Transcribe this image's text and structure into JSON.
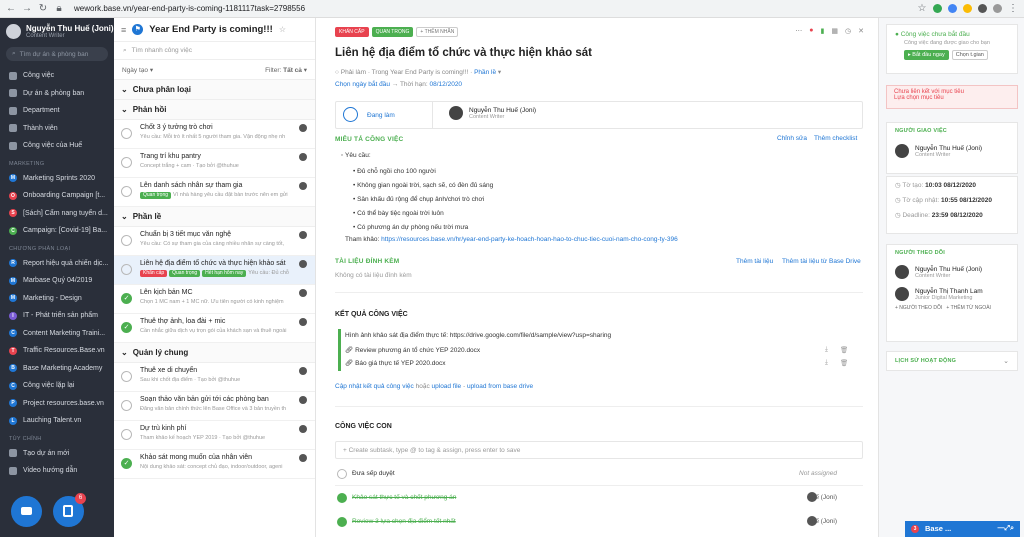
{
  "browser": {
    "url": "wework.base.vn/year-end-party-is-coming-1181117task=2798556"
  },
  "sidebar": {
    "user_name": "Nguyễn Thu Huế (Joni)",
    "user_role": "Content Writer",
    "search_placeholder": "Tìm dự án & phòng ban",
    "main_items": [
      {
        "label": "Công việc"
      },
      {
        "label": "Dự án & phòng ban"
      },
      {
        "label": "Department"
      },
      {
        "label": "Thành viên"
      },
      {
        "label": "Công việc của Huế"
      }
    ],
    "section_marketing": "MARKETING",
    "marketing_items": [
      {
        "label": "Marketing Sprints 2020",
        "letter": "M",
        "color": "#1f76d4"
      },
      {
        "label": "Onboarding Campaign [t...",
        "letter": "O",
        "color": "#e8434f"
      },
      {
        "label": "[Sách] Cẩm nang tuyển d...",
        "letter": "S",
        "color": "#e8434f"
      },
      {
        "label": "Campaign: [Covid-19] Ba...",
        "letter": "C",
        "color": "#4caf50"
      }
    ],
    "section_chapter": "CHƯƠNG PHÂN LOẠI",
    "chapter_items": [
      {
        "label": "Report hiệu quả chiến dịc...",
        "letter": "R",
        "color": "#1f76d4"
      },
      {
        "label": "Marbase Quý 04/2019",
        "letter": "M",
        "color": "#1f76d4"
      },
      {
        "label": "Marketing - Design",
        "letter": "M",
        "color": "#1f76d4"
      },
      {
        "label": "IT - Phát triển sản phẩm",
        "letter": "I",
        "color": "#7b5cd6"
      },
      {
        "label": "Content Marketing Traini...",
        "letter": "C",
        "color": "#1f76d4"
      },
      {
        "label": "Traffic Resources.Base.vn",
        "letter": "T",
        "color": "#e8434f"
      },
      {
        "label": "Base Marketing Academy",
        "letter": "B",
        "color": "#1f76d4"
      },
      {
        "label": "Công việc lặp lại",
        "letter": "C",
        "color": "#1f76d4"
      },
      {
        "label": "Project resources.base.vn",
        "letter": "P",
        "color": "#1f76d4"
      },
      {
        "label": "Lauching Talent.vn",
        "letter": "L",
        "color": "#1f76d4"
      }
    ],
    "section_custom": "TÙY CHỈNH",
    "custom_items": [
      {
        "label": "Tạo dự án mới"
      },
      {
        "label": "Video hướng dẫn"
      }
    ],
    "fab_badge": "6"
  },
  "list": {
    "project_title": "Year End Party is coming!!!",
    "search_placeholder": "Tìm nhanh công việc",
    "sort_label": "Ngày tạo",
    "filter_label": "Filter:",
    "filter_value": "Tất cả",
    "groups": [
      {
        "name": "Chưa phân loại",
        "tasks": []
      },
      {
        "name": "Phản hồi",
        "tasks": [
          {
            "title": "Chốt 3 ý tưởng trò chơi",
            "sub": "Yêu cầu: Mỗi trò ít nhất 5 người tham gia. Vận động nhẹ nh",
            "done": false
          },
          {
            "title": "Trang trí khu pantry",
            "sub": "Concept trắng + cam · Tạo bởi @thuhue",
            "done": false
          },
          {
            "title": "Lên danh sách nhân sự tham gia",
            "sub": "Vì nhà hàng yêu cầu đặt bàn trước nên em gửi",
            "done": false,
            "tags": [
              {
                "t": "Quan trọng",
                "c": "#4caf50"
              }
            ]
          }
        ]
      },
      {
        "name": "Phần lề",
        "tasks": [
          {
            "title": "Chuẩn bị 3 tiết mục văn nghệ",
            "sub": "Yêu cầu: Có sự tham gia của càng nhiều nhân sự càng tốt,",
            "done": false
          },
          {
            "title": "Liên hệ địa điểm tổ chức và thực hiện khảo sát",
            "sub": "Yêu cầu: Đủ chỗ",
            "done": false,
            "sel": true,
            "tags": [
              {
                "t": "Khẩn cấp",
                "c": "#e8434f"
              },
              {
                "t": "Quan trọng",
                "c": "#4caf50"
              },
              {
                "t": "Hết hạn hôm nay",
                "c": "#4caf50"
              }
            ]
          },
          {
            "title": "Lên kịch bản MC",
            "sub": "Chọn 1 MC nam + 1 MC nữ. Ưu tiên người có kinh nghiệm",
            "done": true
          },
          {
            "title": "Thuê thợ ảnh, loa đài + mic",
            "sub": "Cần nhắc giữa dịch vụ trọn gói của khách sạn và thuê ngoài",
            "done": true
          }
        ]
      },
      {
        "name": "Quản lý chung",
        "tasks": [
          {
            "title": "Thuê xe di chuyển",
            "sub": "Sau khi chốt địa điểm · Tạo bởi @thuhue",
            "done": false
          },
          {
            "title": "Soạn thảo văn bản gửi tới các phòng ban",
            "sub": "Đăng văn bản chính thức lên Base Office và 3 bản truyền th",
            "done": false
          },
          {
            "title": "Dự trù kinh phí",
            "sub": "Tham khảo kế hoạch YEP 2019 · Tạo bởi @thuhue",
            "done": false
          },
          {
            "title": "Khảo sát mong muốn của nhân viên",
            "sub": "Nội dung khảo sát: concept chủ đạo, indoor/outdoor, ageni",
            "done": true
          }
        ]
      }
    ]
  },
  "detail": {
    "tags": [
      {
        "t": "KHẨN CẤP",
        "bg": "#e8434f",
        "fg": "#ffffff"
      },
      {
        "t": "QUAN TRỌNG",
        "bg": "#4caf50",
        "fg": "#ffffff"
      },
      {
        "t": "+ THÊM NHÃN",
        "bg": "#ffffff",
        "fg": "#777777"
      }
    ],
    "title": "Liên hệ địa điểm tổ chức và thực hiện khảo sát",
    "meta": "Phải làm · Trong Year End Party is coming!!!",
    "meta_link": "Phần lề",
    "start_date": "Chọn ngày bắt đầu",
    "deadline_label": "Thời hạn:",
    "deadline": "08/12/2020",
    "status": "Đang làm",
    "assignee_name": "Nguyễn Thu Huế (Joni)",
    "assignee_role": "Content Writer",
    "desc_header": "MIÊU TẢ CÔNG VIỆC",
    "desc_edit": "Chỉnh sửa",
    "desc_checklist": "Thêm checklist",
    "req_label": "Yêu cầu:",
    "requirements": [
      "Đủ chỗ ngồi cho 100 người",
      "Không gian ngoài trời, sạch sẽ, có đèn đủ sáng",
      "Sân khấu đủ rộng để chụp ảnh/chơi trò chơi",
      "Có thể bày tiệc ngoài trời luôn",
      "Có phương án dự phòng nếu trời mưa"
    ],
    "ref_label": "Tham khảo:",
    "ref_link": "https://resources.base.vn/hr/year-end-party-ke-hoach-hoan-hao-to-chuc-tiec-cuoi-nam-cho-cong-ty-396",
    "attach_header": "TÀI LIỆU ĐÍNH KÈM",
    "attach_add": "Thêm tài liệu",
    "attach_drive": "Thêm tài liệu từ Base Drive",
    "attach_empty": "Không có tài liệu đính kèm",
    "result_header": "KẾT QUẢ CÔNG VIỆC",
    "result_text": "Hình ảnh khảo sát địa điểm thực tế: https://drive.google.com/file/d/sample/view?usp=sharing",
    "result_files": [
      "Review phương án tổ chức YEP 2020.docx",
      "Báo giá thực tế YEP 2020.docx"
    ],
    "result_update": "Cập nhật kết quả công việc",
    "result_or": "hoặc",
    "result_upload": "upload file",
    "result_from_drive": "upload from base drive",
    "subtask_header": "CÔNG VIỆC CON",
    "subtask_placeholder": "Create subtask, type @ to tag & assign, press enter to save",
    "subtasks": [
      {
        "title": "Đưa sếp duyệt",
        "who": "Not assigned",
        "done": false
      },
      {
        "title": "Khảo sát thực tế và chốt phương án",
        "who": "Huế (Joni)",
        "done": true
      },
      {
        "title": "Review 3 lựa chọn địa điểm tốt nhất",
        "who": "Huế (Joni)",
        "done": true
      }
    ]
  },
  "right": {
    "not_started_title": "Công việc chưa bắt đầu",
    "not_started_desc": "Công việc đang được giao cho bạn",
    "start_btn": "▸ Bắt đầu ngay",
    "time_btn": "Chọn t.gian",
    "warn_title": "Chưa liên kết với mục tiêu",
    "warn_link": "Lựa chọn mục tiêu",
    "assigner_header": "NGƯỜI GIAO VIỆC",
    "assigner_name": "Nguyễn Thu Huế (Joni)",
    "assigner_role": "Content Writer",
    "created_label": "Tờ tạo:",
    "created": "10:03 08/12/2020",
    "updated_label": "Tờ cập nhật:",
    "updated": "10:55 08/12/2020",
    "deadline_label": "Deadline:",
    "deadline": "23:59 08/12/2020",
    "followers_header": "NGƯỜI THEO DÕI",
    "followers": [
      {
        "name": "Nguyễn Thu Huế (Joni)",
        "role": "Content Writer"
      },
      {
        "name": "Nguyễn Thị Thanh Lam",
        "role": "Junior Digital Marketing"
      }
    ],
    "add_follower": "+ NGƯỜI THEO DÕI",
    "add_outside": "+ THÊM TỪ NGOÀI",
    "history_header": "LỊCH SỬ HOẠT ĐỘNG"
  },
  "chat": {
    "label": "Base ...",
    "badge": "3"
  }
}
